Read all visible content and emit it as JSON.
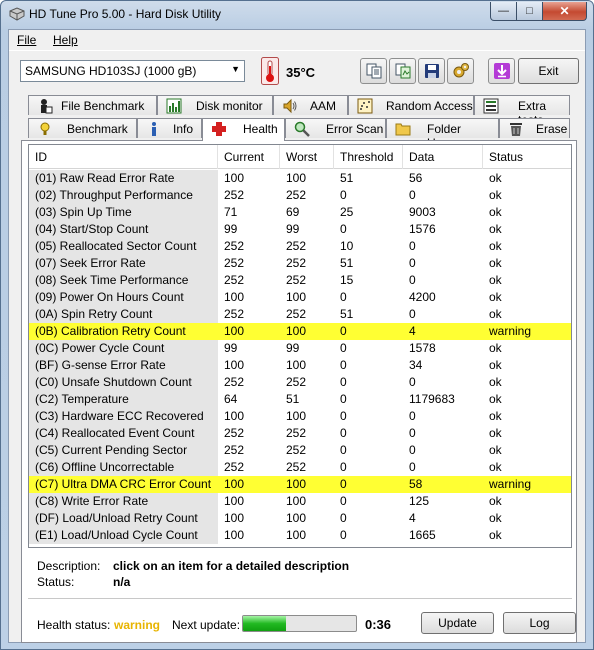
{
  "window": {
    "title": "HD Tune Pro 5.00 - Hard Disk Utility",
    "minimize_glyph": "—",
    "maximize_glyph": "□",
    "close_glyph": "✕"
  },
  "menu": {
    "file": "File",
    "help": "Help"
  },
  "toolbar": {
    "drive": "SAMSUNG HD103SJ (1000 gB)",
    "temperature": "35°C",
    "buttons": [
      "copy-info-icon",
      "copy-screenshot-icon",
      "save-icon",
      "options-icon",
      "download-icon"
    ],
    "exit_label": "Exit"
  },
  "tabs": {
    "row1": [
      "File Benchmark",
      "Disk monitor",
      "AAM",
      "Random Access",
      "Extra tests"
    ],
    "row2": [
      "Benchmark",
      "Info",
      "Health",
      "Error Scan",
      "Folder Usage",
      "Erase"
    ],
    "active": "Health"
  },
  "table": {
    "headers": [
      "ID",
      "Current",
      "Worst",
      "Threshold",
      "Data",
      "Status"
    ],
    "rows": [
      [
        "(01) Raw Read Error Rate",
        "100",
        "100",
        "51",
        "56",
        "ok"
      ],
      [
        "(02) Throughput Performance",
        "252",
        "252",
        "0",
        "0",
        "ok"
      ],
      [
        "(03) Spin Up Time",
        "71",
        "69",
        "25",
        "9003",
        "ok"
      ],
      [
        "(04) Start/Stop Count",
        "99",
        "99",
        "0",
        "1576",
        "ok"
      ],
      [
        "(05) Reallocated Sector Count",
        "252",
        "252",
        "10",
        "0",
        "ok"
      ],
      [
        "(07) Seek Error Rate",
        "252",
        "252",
        "51",
        "0",
        "ok"
      ],
      [
        "(08) Seek Time Performance",
        "252",
        "252",
        "15",
        "0",
        "ok"
      ],
      [
        "(09) Power On Hours Count",
        "100",
        "100",
        "0",
        "4200",
        "ok"
      ],
      [
        "(0A) Spin Retry Count",
        "252",
        "252",
        "51",
        "0",
        "ok"
      ],
      [
        "(0B) Calibration Retry Count",
        "100",
        "100",
        "0",
        "4",
        "warning"
      ],
      [
        "(0C) Power Cycle Count",
        "99",
        "99",
        "0",
        "1578",
        "ok"
      ],
      [
        "(BF) G-sense Error Rate",
        "100",
        "100",
        "0",
        "34",
        "ok"
      ],
      [
        "(C0) Unsafe Shutdown Count",
        "252",
        "252",
        "0",
        "0",
        "ok"
      ],
      [
        "(C2) Temperature",
        "64",
        "51",
        "0",
        "1179683",
        "ok"
      ],
      [
        "(C3) Hardware ECC Recovered",
        "100",
        "100",
        "0",
        "0",
        "ok"
      ],
      [
        "(C4) Reallocated Event Count",
        "252",
        "252",
        "0",
        "0",
        "ok"
      ],
      [
        "(C5) Current Pending Sector",
        "252",
        "252",
        "0",
        "0",
        "ok"
      ],
      [
        "(C6) Offline Uncorrectable",
        "252",
        "252",
        "0",
        "0",
        "ok"
      ],
      [
        "(C7) Ultra DMA CRC Error Count",
        "100",
        "100",
        "0",
        "58",
        "warning"
      ],
      [
        "(C8) Write Error Rate",
        "100",
        "100",
        "0",
        "125",
        "ok"
      ],
      [
        "(DF) Load/Unload Retry Count",
        "100",
        "100",
        "0",
        "4",
        "ok"
      ],
      [
        "(E1) Load/Unload Cycle Count",
        "100",
        "100",
        "0",
        "1665",
        "ok"
      ]
    ]
  },
  "details": {
    "description_label": "Description:",
    "description_value": "click on an item for a detailed description",
    "status_label": "Status:",
    "status_value": "n/a"
  },
  "footer": {
    "health_label": "Health status:",
    "health_value": "warning",
    "next_update_label": "Next update:",
    "progress_fraction": 0.38,
    "countdown": "0:36",
    "update_label": "Update",
    "log_label": "Log"
  },
  "colors": {
    "warning_row": "#ffff33",
    "warning_text": "#e8b400"
  }
}
